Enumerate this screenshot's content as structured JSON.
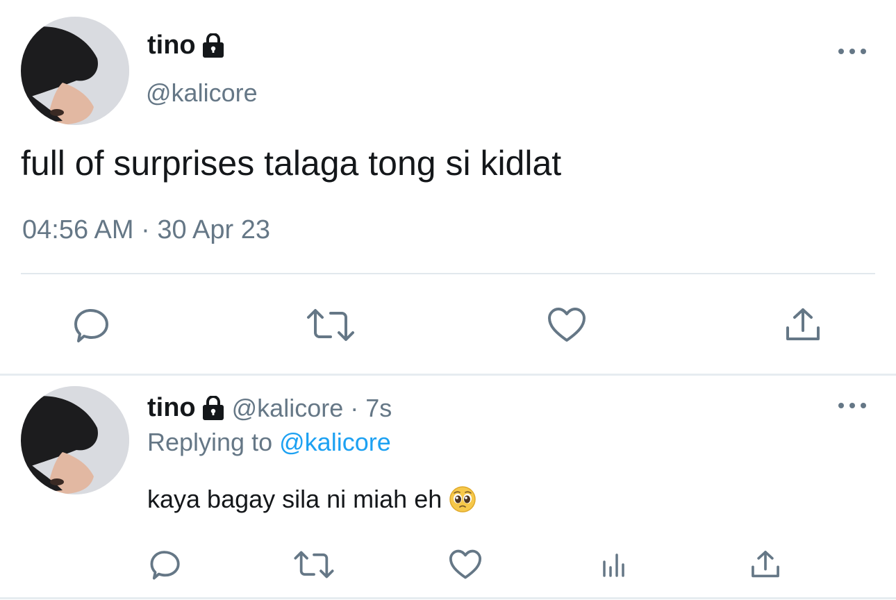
{
  "main_tweet": {
    "display_name": "tino",
    "handle": "@kalicore",
    "text": "full of surprises talaga tong si kidlat",
    "timestamp": "04:56 AM · 30 Apr 23",
    "icons": {
      "protected": "lock-icon",
      "more": "more-options-icon",
      "reply": "reply-icon",
      "retweet": "retweet-icon",
      "like": "like-icon",
      "share": "share-icon"
    }
  },
  "reply_tweet": {
    "display_name": "tino",
    "handle": "@kalicore",
    "separator": "·",
    "time_ago": "7s",
    "replying_prefix": "Replying to",
    "replying_to": "@kalicore",
    "text": "kaya bagay sila ni miah eh",
    "emoji": "pleading-face-emoji",
    "icons": {
      "protected": "lock-icon",
      "more": "more-options-icon",
      "reply": "reply-icon",
      "retweet": "retweet-icon",
      "like": "like-icon",
      "analytics": "analytics-icon",
      "share": "share-icon"
    }
  },
  "colors": {
    "text_primary": "#14171a",
    "text_secondary": "#657786",
    "link": "#1da1f2",
    "divider": "#e1e8ed"
  }
}
